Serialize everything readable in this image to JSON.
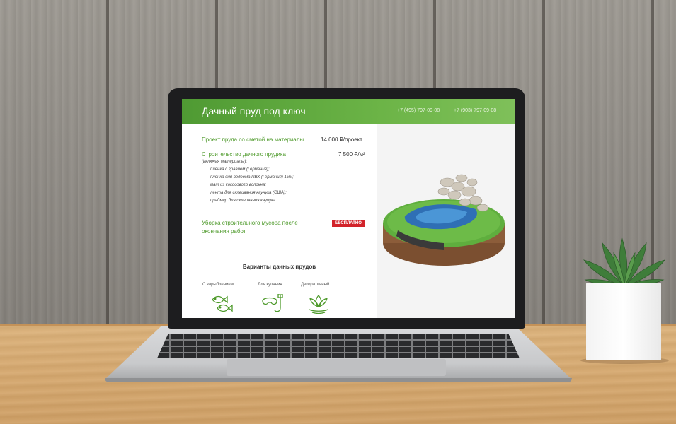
{
  "page": {
    "title": "Дачный пруд под ключ",
    "phones": [
      "+7 (495) 797-09-08",
      "+7 (903) 797-09-08"
    ]
  },
  "services": [
    {
      "name": "Проект пруда со сметой на материалы",
      "price": "14 000 ₽/проект"
    },
    {
      "name": "Строительство дачного прудика",
      "price": "7 500 ₽/м²",
      "note": "(включая  материалы):",
      "materials": [
        "пленка с гравием (Германия);",
        "пленка для водоема ПВХ (Германия) 1мм;",
        "мат из кокосового волокна;",
        "лента для склеивания каучука (США);",
        "праймер для склеивания каучука."
      ]
    },
    {
      "name_line1": "Уборка строительного мусора после",
      "name_line2": "окончания работ",
      "badge": "БЕСПЛАТНО"
    }
  ],
  "variants": {
    "title": "Варианты дачных прудов",
    "items": [
      {
        "label": "С зарыблением",
        "icon": "fish-icon"
      },
      {
        "label": "Для купания",
        "icon": "snorkel-icon"
      },
      {
        "label": "Декоративный",
        "icon": "lotus-icon"
      }
    ]
  },
  "colors": {
    "accent": "#5aa73a",
    "badge": "#d2232a"
  }
}
